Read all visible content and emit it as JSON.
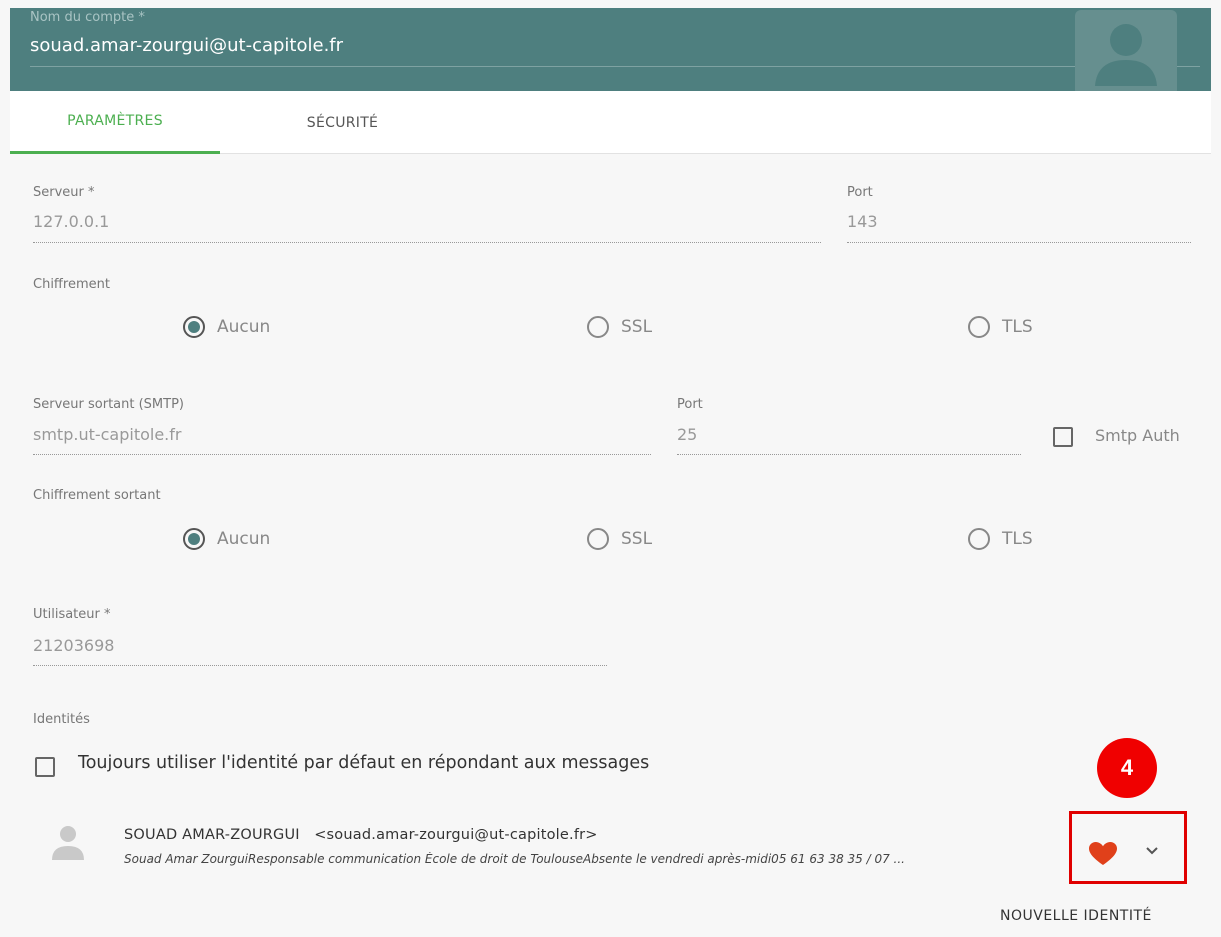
{
  "account": {
    "label": "Nom du compte *",
    "value": "souad.amar-zourgui@ut-capitole.fr"
  },
  "tabs": [
    {
      "label": "PARAMÈTRES",
      "active": true
    },
    {
      "label": "SÉCURITÉ",
      "active": false
    }
  ],
  "incoming": {
    "server_label": "Serveur *",
    "server_value": "127.0.0.1",
    "port_label": "Port",
    "port_value": "143",
    "encryption_label": "Chiffrement",
    "options": [
      "Aucun",
      "SSL",
      "TLS"
    ],
    "selected": "Aucun"
  },
  "outgoing": {
    "server_label": "Serveur sortant (SMTP)",
    "server_value": "smtp.ut-capitole.fr",
    "port_label": "Port",
    "port_value": "25",
    "smtp_auth_label": "Smtp Auth",
    "smtp_auth_checked": false,
    "encryption_label": "Chiffrement sortant",
    "options": [
      "Aucun",
      "SSL",
      "TLS"
    ],
    "selected": "Aucun"
  },
  "user": {
    "label": "Utilisateur *",
    "value": "21203698"
  },
  "identities": {
    "label": "Identités",
    "default_checkbox_label": "Toujours utiliser l'identité par défaut en répondant aux messages",
    "default_checkbox_checked": false,
    "items": [
      {
        "name": "SOUAD AMAR-ZOURGUI",
        "email": "<souad.amar-zourgui@ut-capitole.fr>",
        "signature": "Souad Amar ZourguiResponsable communication École de droit de ToulouseAbsente le vendredi après-midi05 61 63 38 35 / 07 ..."
      }
    ],
    "new_button": "NOUVELLE IDENTITÉ"
  },
  "annotation": {
    "badge": "4"
  },
  "colors": {
    "header": "#4e7f7f",
    "accent": "#4caf50",
    "heart": "#e0401a",
    "annotation": "#f00000"
  }
}
